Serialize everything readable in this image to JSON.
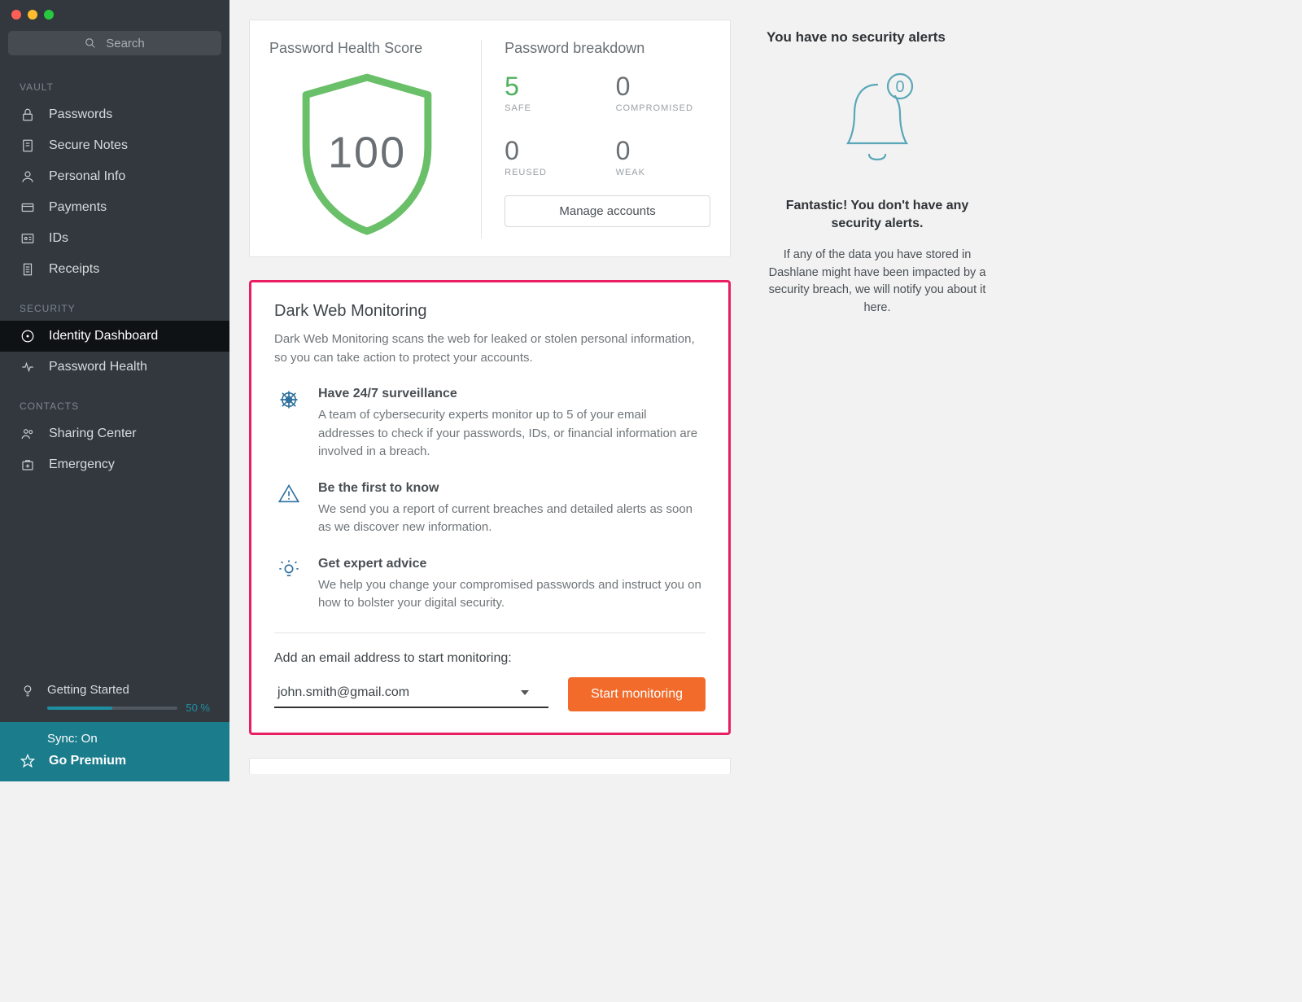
{
  "search": {
    "placeholder": "Search"
  },
  "sidebar": {
    "sections": {
      "vault": {
        "label": "VAULT",
        "items": [
          {
            "label": "Passwords"
          },
          {
            "label": "Secure Notes"
          },
          {
            "label": "Personal Info"
          },
          {
            "label": "Payments"
          },
          {
            "label": "IDs"
          },
          {
            "label": "Receipts"
          }
        ]
      },
      "security": {
        "label": "SECURITY",
        "items": [
          {
            "label": "Identity Dashboard"
          },
          {
            "label": "Password Health"
          }
        ]
      },
      "contacts": {
        "label": "CONTACTS",
        "items": [
          {
            "label": "Sharing Center"
          },
          {
            "label": "Emergency"
          }
        ]
      }
    },
    "getting_started": {
      "label": "Getting Started",
      "percent_text": "50 %",
      "percent": 50
    },
    "sync": "Sync: On",
    "premium": "Go Premium"
  },
  "health": {
    "title": "Password Health Score",
    "score": "100"
  },
  "breakdown": {
    "title": "Password breakdown",
    "safe": {
      "value": "5",
      "label": "SAFE"
    },
    "compromised": {
      "value": "0",
      "label": "COMPROMISED"
    },
    "reused": {
      "value": "0",
      "label": "REUSED"
    },
    "weak": {
      "value": "0",
      "label": "WEAK"
    },
    "manage_button": "Manage accounts"
  },
  "darkweb": {
    "title": "Dark Web Monitoring",
    "description": "Dark Web Monitoring scans the web for leaked or stolen personal information, so you can take action to protect your accounts.",
    "features": [
      {
        "title": "Have 24/7 surveillance",
        "body": "A team of cybersecurity experts monitor up to 5 of your email addresses to check if your passwords, IDs, or financial information are involved in a breach."
      },
      {
        "title": "Be the first to know",
        "body": "We send you a report of current breaches and detailed alerts as soon as we discover new information."
      },
      {
        "title": "Get expert advice",
        "body": "We help you change your compromised passwords and instruct you on how to bolster your digital security."
      }
    ],
    "email_label": "Add an email address to start monitoring:",
    "email_value": "john.smith@gmail.com",
    "start_button": "Start monitoring"
  },
  "alerts": {
    "title": "You have no security alerts",
    "badge": "0",
    "subtitle": "Fantastic! You don't have any security alerts.",
    "body": "If any of the data you have stored in Dashlane might have been impacted by a security breach, we will notify you about it here."
  }
}
